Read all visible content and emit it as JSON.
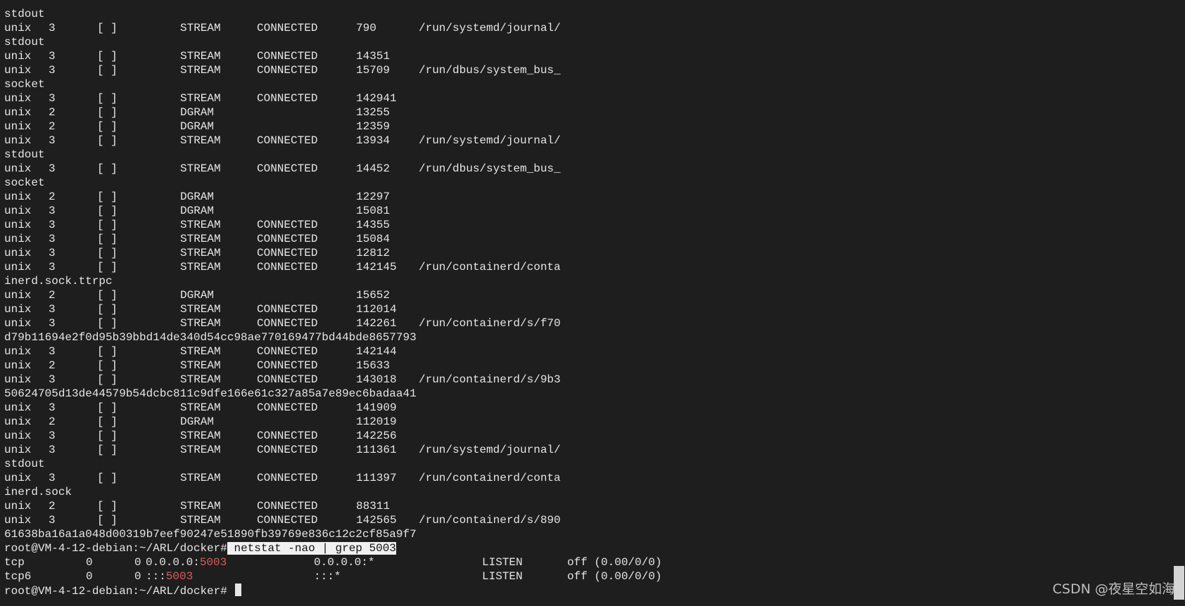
{
  "terminal": {
    "lines": [
      {
        "kind": "text",
        "text": "stdout"
      },
      {
        "kind": "unix",
        "proto": "unix",
        "refcnt": "3",
        "flags": "[ ]",
        "type": "STREAM",
        "state": "CONNECTED",
        "inode": "790",
        "path": "/run/systemd/journal/"
      },
      {
        "kind": "text",
        "text": "stdout"
      },
      {
        "kind": "unix",
        "proto": "unix",
        "refcnt": "3",
        "flags": "[ ]",
        "type": "STREAM",
        "state": "CONNECTED",
        "inode": "14351",
        "path": ""
      },
      {
        "kind": "unix",
        "proto": "unix",
        "refcnt": "3",
        "flags": "[ ]",
        "type": "STREAM",
        "state": "CONNECTED",
        "inode": "15709",
        "path": "/run/dbus/system_bus_"
      },
      {
        "kind": "text",
        "text": "socket"
      },
      {
        "kind": "unix",
        "proto": "unix",
        "refcnt": "3",
        "flags": "[ ]",
        "type": "STREAM",
        "state": "CONNECTED",
        "inode": "142941",
        "path": ""
      },
      {
        "kind": "unix",
        "proto": "unix",
        "refcnt": "2",
        "flags": "[ ]",
        "type": "DGRAM",
        "state": "",
        "inode": "13255",
        "path": ""
      },
      {
        "kind": "unix",
        "proto": "unix",
        "refcnt": "2",
        "flags": "[ ]",
        "type": "DGRAM",
        "state": "",
        "inode": "12359",
        "path": ""
      },
      {
        "kind": "unix",
        "proto": "unix",
        "refcnt": "3",
        "flags": "[ ]",
        "type": "STREAM",
        "state": "CONNECTED",
        "inode": "13934",
        "path": "/run/systemd/journal/"
      },
      {
        "kind": "text",
        "text": "stdout"
      },
      {
        "kind": "unix",
        "proto": "unix",
        "refcnt": "3",
        "flags": "[ ]",
        "type": "STREAM",
        "state": "CONNECTED",
        "inode": "14452",
        "path": "/run/dbus/system_bus_"
      },
      {
        "kind": "text",
        "text": "socket"
      },
      {
        "kind": "unix",
        "proto": "unix",
        "refcnt": "2",
        "flags": "[ ]",
        "type": "DGRAM",
        "state": "",
        "inode": "12297",
        "path": ""
      },
      {
        "kind": "unix",
        "proto": "unix",
        "refcnt": "3",
        "flags": "[ ]",
        "type": "DGRAM",
        "state": "",
        "inode": "15081",
        "path": ""
      },
      {
        "kind": "unix",
        "proto": "unix",
        "refcnt": "3",
        "flags": "[ ]",
        "type": "STREAM",
        "state": "CONNECTED",
        "inode": "14355",
        "path": ""
      },
      {
        "kind": "unix",
        "proto": "unix",
        "refcnt": "3",
        "flags": "[ ]",
        "type": "STREAM",
        "state": "CONNECTED",
        "inode": "15084",
        "path": ""
      },
      {
        "kind": "unix",
        "proto": "unix",
        "refcnt": "3",
        "flags": "[ ]",
        "type": "STREAM",
        "state": "CONNECTED",
        "inode": "12812",
        "path": ""
      },
      {
        "kind": "unix",
        "proto": "unix",
        "refcnt": "3",
        "flags": "[ ]",
        "type": "STREAM",
        "state": "CONNECTED",
        "inode": "142145",
        "path": "/run/containerd/conta"
      },
      {
        "kind": "text",
        "text": "inerd.sock.ttrpc"
      },
      {
        "kind": "unix",
        "proto": "unix",
        "refcnt": "2",
        "flags": "[ ]",
        "type": "DGRAM",
        "state": "",
        "inode": "15652",
        "path": ""
      },
      {
        "kind": "unix",
        "proto": "unix",
        "refcnt": "3",
        "flags": "[ ]",
        "type": "STREAM",
        "state": "CONNECTED",
        "inode": "112014",
        "path": ""
      },
      {
        "kind": "unix",
        "proto": "unix",
        "refcnt": "3",
        "flags": "[ ]",
        "type": "STREAM",
        "state": "CONNECTED",
        "inode": "142261",
        "path": "/run/containerd/s/f70"
      },
      {
        "kind": "text",
        "text": "d79b11694e2f0d95b39bbd14de340d54cc98ae770169477bd44bde8657793"
      },
      {
        "kind": "unix",
        "proto": "unix",
        "refcnt": "3",
        "flags": "[ ]",
        "type": "STREAM",
        "state": "CONNECTED",
        "inode": "142144",
        "path": ""
      },
      {
        "kind": "unix",
        "proto": "unix",
        "refcnt": "2",
        "flags": "[ ]",
        "type": "STREAM",
        "state": "CONNECTED",
        "inode": "15633",
        "path": ""
      },
      {
        "kind": "unix",
        "proto": "unix",
        "refcnt": "3",
        "flags": "[ ]",
        "type": "STREAM",
        "state": "CONNECTED",
        "inode": "143018",
        "path": "/run/containerd/s/9b3"
      },
      {
        "kind": "text",
        "text": "50624705d13de44579b54dcbc811c9dfe166e61c327a85a7e89ec6badaa41"
      },
      {
        "kind": "unix",
        "proto": "unix",
        "refcnt": "3",
        "flags": "[ ]",
        "type": "STREAM",
        "state": "CONNECTED",
        "inode": "141909",
        "path": ""
      },
      {
        "kind": "unix",
        "proto": "unix",
        "refcnt": "2",
        "flags": "[ ]",
        "type": "DGRAM",
        "state": "",
        "inode": "112019",
        "path": ""
      },
      {
        "kind": "unix",
        "proto": "unix",
        "refcnt": "3",
        "flags": "[ ]",
        "type": "STREAM",
        "state": "CONNECTED",
        "inode": "142256",
        "path": ""
      },
      {
        "kind": "unix",
        "proto": "unix",
        "refcnt": "3",
        "flags": "[ ]",
        "type": "STREAM",
        "state": "CONNECTED",
        "inode": "111361",
        "path": "/run/systemd/journal/"
      },
      {
        "kind": "text",
        "text": "stdout"
      },
      {
        "kind": "unix",
        "proto": "unix",
        "refcnt": "3",
        "flags": "[ ]",
        "type": "STREAM",
        "state": "CONNECTED",
        "inode": "111397",
        "path": "/run/containerd/conta"
      },
      {
        "kind": "text",
        "text": "inerd.sock"
      },
      {
        "kind": "unix",
        "proto": "unix",
        "refcnt": "2",
        "flags": "[ ]",
        "type": "STREAM",
        "state": "CONNECTED",
        "inode": "88311",
        "path": ""
      },
      {
        "kind": "unix",
        "proto": "unix",
        "refcnt": "3",
        "flags": "[ ]",
        "type": "STREAM",
        "state": "CONNECTED",
        "inode": "142565",
        "path": "/run/containerd/s/890"
      },
      {
        "kind": "text",
        "text": "61638ba16a1a048d00319b7eef90247e51890fb39769e836c12c2cf85a9f7"
      },
      {
        "kind": "prompt",
        "prompt": "root@VM-4-12-debian:~/ARL/docker#",
        "command": " netstat -nao | grep 5003"
      },
      {
        "kind": "tcp",
        "proto": "tcp",
        "recvq": "0",
        "sendq": "0",
        "local_prefix": "0.0.0.0:",
        "local_port": "5003",
        "foreign": "0.0.0.0:*",
        "state": "LISTEN",
        "timer": "off (0.00/0/0)"
      },
      {
        "kind": "tcp",
        "proto": "tcp6",
        "recvq": "0",
        "sendq": "0",
        "local_prefix": ":::",
        "local_port": "5003",
        "foreign": ":::*",
        "state": "LISTEN",
        "timer": "off (0.00/0/0)"
      },
      {
        "kind": "prompt",
        "prompt": "root@VM-4-12-debian:~/ARL/docker#",
        "command": "",
        "cursor": true
      }
    ]
  },
  "watermark": "CSDN @夜星空如海",
  "colors": {
    "background": "#1e1e1e",
    "foreground": "#e6e6e6",
    "match": "#e05a5a",
    "selection": "#f0f0f0"
  }
}
